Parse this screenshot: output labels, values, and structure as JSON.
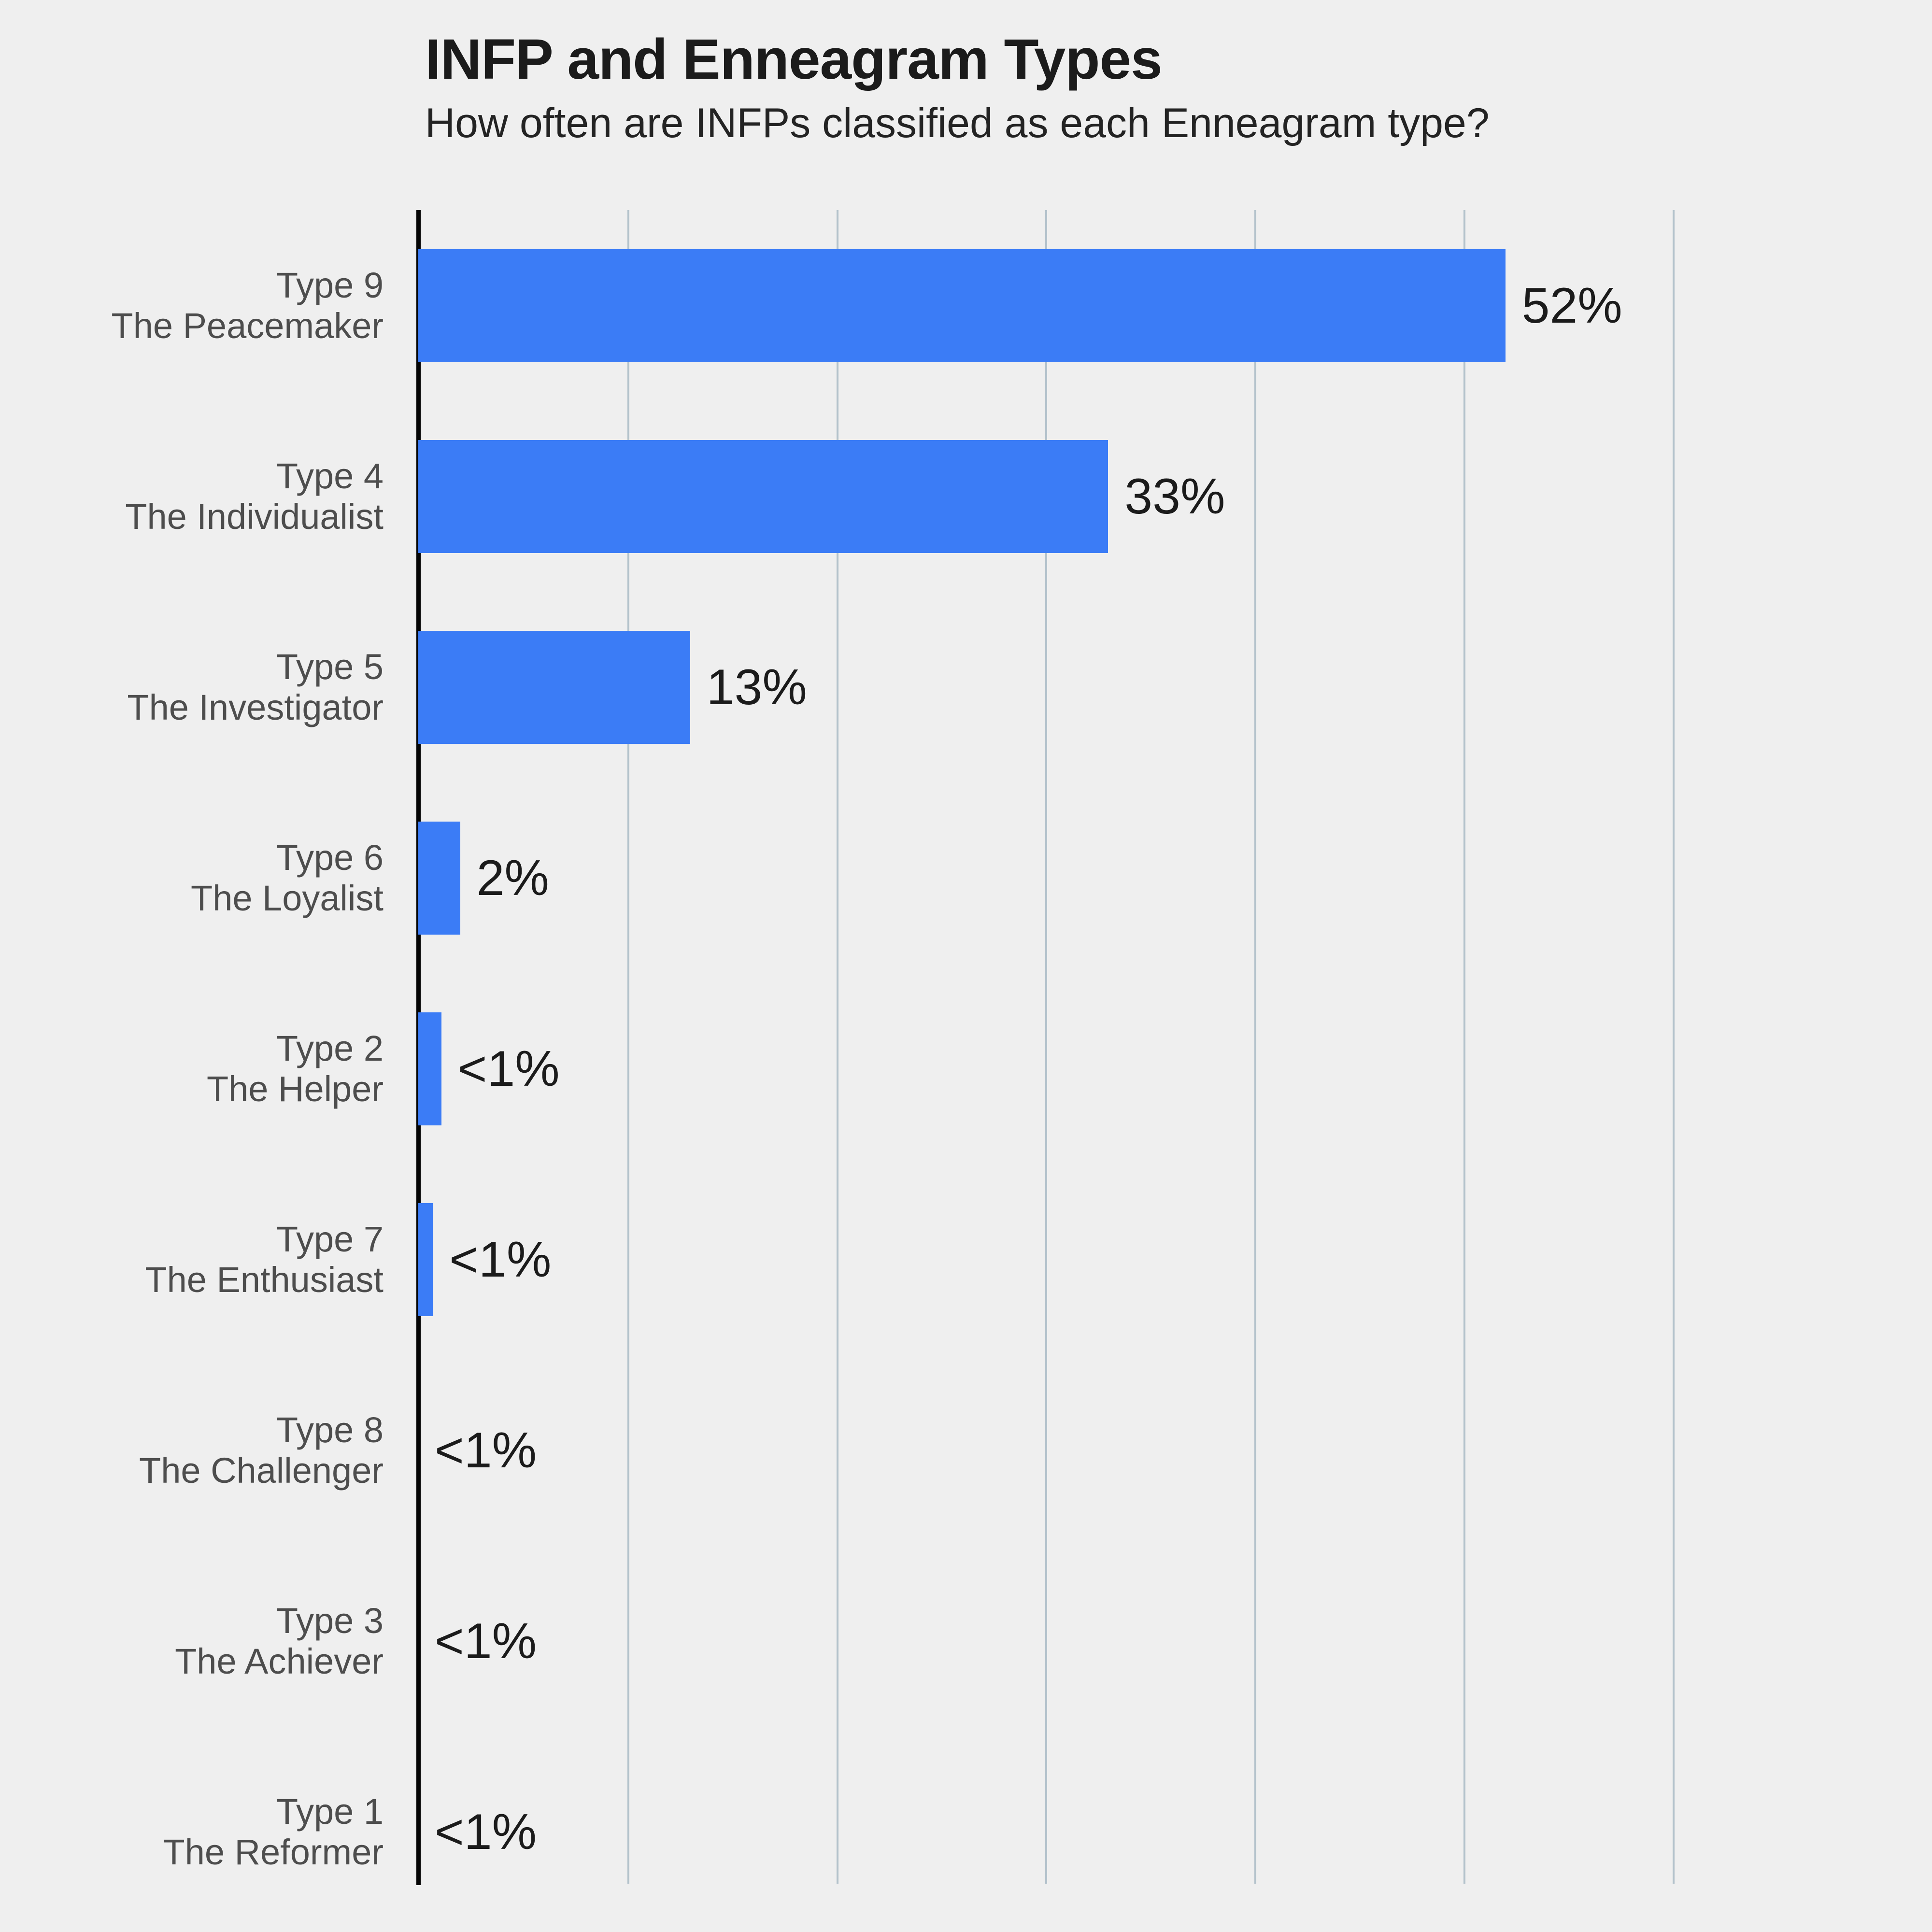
{
  "header": {
    "title": "INFP and Enneagram Types",
    "subtitle": "How often are INFPs classified as each Enneagram type?"
  },
  "colors": {
    "background": "#efefef",
    "bar": "#3b7cf6",
    "axis": "#050505",
    "gridline": "#b3c2cb",
    "category_label": "#4d4d4d",
    "value_label": "#1b1b1b",
    "title": "#1b1b1b"
  },
  "chart_data": {
    "type": "bar",
    "orientation": "horizontal",
    "title": "INFP and Enneagram Types",
    "subtitle": "How often are INFPs classified as each Enneagram type?",
    "xlabel": "",
    "ylabel": "",
    "xlim": [
      0,
      64
    ],
    "grid": "vertical",
    "gridline_values": [
      10,
      20,
      30,
      40,
      50,
      60
    ],
    "legend": null,
    "categories": [
      "Type 9\nThe Peacemaker",
      "Type 4\nThe Individualist",
      "Type 5\nThe Investigator",
      "Type 6\nThe Loyalist",
      "Type 2\nThe Helper",
      "Type 7\nThe Enthusiast",
      "Type 8\nThe Challenger",
      "Type 3\nThe Achiever",
      "Type 1\nThe Reformer"
    ],
    "values": [
      52,
      33,
      13,
      2,
      1.1,
      0.7,
      0,
      0,
      0
    ],
    "data_labels": [
      "52%",
      "33%",
      "13%",
      "2%",
      "<1%",
      "<1%",
      "<1%",
      "<1%",
      "<1%"
    ],
    "rows": [
      {
        "type": "Type 9",
        "name": "The Peacemaker",
        "value": 52,
        "label": "52%"
      },
      {
        "type": "Type 4",
        "name": "The Individualist",
        "value": 33,
        "label": "33%"
      },
      {
        "type": "Type 5",
        "name": "The Investigator",
        "value": 13,
        "label": "13%"
      },
      {
        "type": "Type 6",
        "name": "The Loyalist",
        "value": 2,
        "label": "2%"
      },
      {
        "type": "Type 2",
        "name": "The Helper",
        "value": 1.1,
        "label": "<1%"
      },
      {
        "type": "Type 7",
        "name": "The Enthusiast",
        "value": 0.7,
        "label": "<1%"
      },
      {
        "type": "Type 8",
        "name": "The Challenger",
        "value": 0,
        "label": "<1%"
      },
      {
        "type": "Type 3",
        "name": "The Achiever",
        "value": 0,
        "label": "<1%"
      },
      {
        "type": "Type 1",
        "name": "The Reformer",
        "value": 0,
        "label": "<1%"
      }
    ]
  }
}
